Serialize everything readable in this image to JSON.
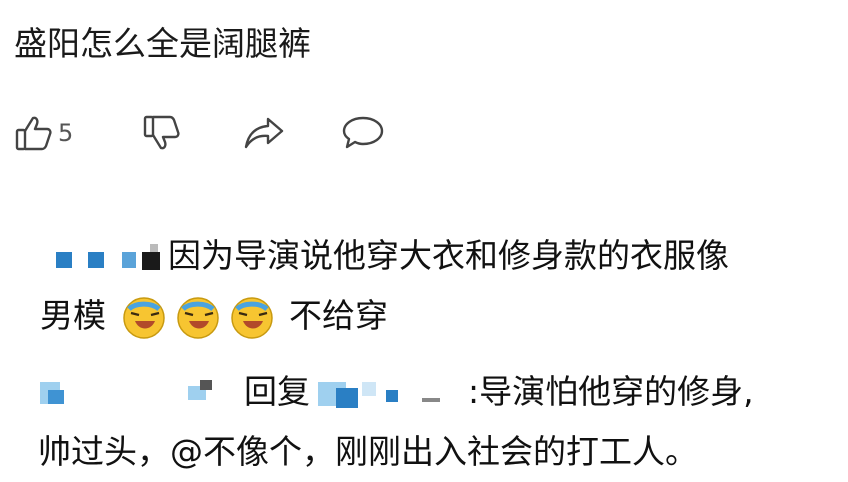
{
  "post": {
    "text": "盛阳怎么全是阔腿裤"
  },
  "actions": {
    "like_count": "5",
    "like_icon": "thumbs-up-icon",
    "dislike_icon": "thumbs-down-icon",
    "share_icon": "share-arrow-icon",
    "comment_icon": "comment-bubble-icon"
  },
  "comment1": {
    "text_a": "因为导演说他穿大衣和修身款的衣服像",
    "text_b": "男模",
    "emoji": "laughing-crying-emoji",
    "text_c": "不给穿"
  },
  "comment2": {
    "reply_label": "回复",
    "text_a": ":导演怕他穿的修身,",
    "text_b": "帅过头，@不像个，刚刚出入社会的打工人。"
  },
  "colors": {
    "mosaic_blue": "#2a7fc4",
    "mosaic_dark": "#1a1a1a",
    "emoji_yellow": "#f7c531"
  }
}
